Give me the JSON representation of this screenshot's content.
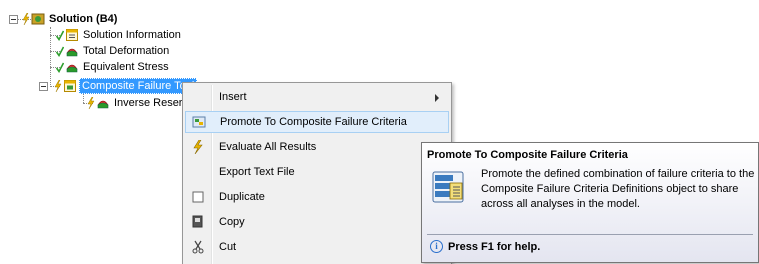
{
  "tree": {
    "solution": {
      "label": "Solution (B4)"
    },
    "children": [
      {
        "label": "Solution Information",
        "icon": "solution-information-icon"
      },
      {
        "label": "Total Deformation",
        "icon": "result-icon"
      },
      {
        "label": "Equivalent Stress",
        "icon": "result-icon"
      }
    ],
    "composite": {
      "label": "Composite Failure Tool"
    },
    "inverse": {
      "label": "Inverse Reserve Factor"
    }
  },
  "menu": {
    "items": [
      {
        "label": "Insert",
        "icon": "",
        "submenu": true
      },
      {
        "label": "Promote To Composite Failure Criteria",
        "icon": "promote-icon"
      },
      {
        "label": "Evaluate All Results",
        "icon": "lightning-icon"
      },
      {
        "label": "Export Text File",
        "icon": ""
      },
      {
        "label": "Duplicate",
        "icon": "duplicate-icon"
      },
      {
        "label": "Copy",
        "icon": "copy-icon"
      },
      {
        "label": "Cut",
        "icon": "cut-icon"
      }
    ]
  },
  "tooltip": {
    "title": "Promote To Composite Failure Criteria",
    "description": "Promote the defined combination of failure criteria to the Composite Failure Criteria Definitions object to share across all analyses in the model.",
    "help": "Press F1 for help."
  },
  "colors": {
    "selection": "#3399ff",
    "menu_background": "#f0f0f0",
    "menu_highlight": "#e1eefb",
    "check_green": "#2e9e2e"
  }
}
